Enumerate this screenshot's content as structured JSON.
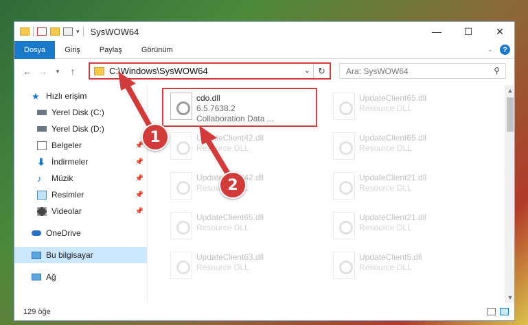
{
  "window": {
    "title": "SysWOW64",
    "controls": {
      "minimize": "—",
      "maximize": "☐",
      "close": "✕"
    }
  },
  "ribbon": {
    "tabs": [
      {
        "label": "Dosya",
        "active": true
      },
      {
        "label": "Giriş",
        "active": false
      },
      {
        "label": "Paylaş",
        "active": false
      },
      {
        "label": "Görünüm",
        "active": false
      }
    ],
    "help": "?"
  },
  "address": {
    "path": "C:\\Windows\\SysWOW64",
    "search_placeholder": "Ara: SysWOW64"
  },
  "sidebar": {
    "items": [
      {
        "label": "Hızlı erişim",
        "icon": "star-icon"
      },
      {
        "label": "Yerel Disk (C:)",
        "icon": "drive-icon"
      },
      {
        "label": "Yerel Disk (D:)",
        "icon": "drive-icon"
      },
      {
        "label": "Belgeler",
        "icon": "document-icon"
      },
      {
        "label": "İndirmeler",
        "icon": "download-icon"
      },
      {
        "label": "Müzik",
        "icon": "music-icon"
      },
      {
        "label": "Resimler",
        "icon": "picture-icon"
      },
      {
        "label": "Videolar",
        "icon": "video-icon"
      },
      {
        "label": "OneDrive",
        "icon": "cloud-icon"
      },
      {
        "label": "Bu bilgisayar",
        "icon": "computer-icon"
      },
      {
        "label": "Ağ",
        "icon": "network-icon"
      }
    ]
  },
  "files": [
    {
      "name": "cdo.dll",
      "line2": "6.5.7638.2",
      "line3": "Collaboration Data ..."
    },
    {
      "name": "UpdateClient65.dll",
      "line2": "Resource DLL"
    },
    {
      "name": "UpdateClient42.dll",
      "line2": "Resource DLL"
    },
    {
      "name": "UpdateClient65.dll",
      "line2": "Resource DLL"
    },
    {
      "name": "UpdateClient42.dll",
      "line2": "Resource DLL"
    },
    {
      "name": "UpdateClient21.dll",
      "line2": "Resource DLL"
    },
    {
      "name": "UpdateClient65.dll",
      "line2": "Resource DLL"
    },
    {
      "name": "UpdateClient21.dll",
      "line2": "Resource DLL"
    },
    {
      "name": "UpdateClient63.dll",
      "line2": "Resource DLL"
    },
    {
      "name": "UpdateClient5.dll",
      "line2": "Resource DLL"
    }
  ],
  "status": {
    "count": "129 öğe"
  },
  "badges": {
    "one": "1",
    "two": "2"
  },
  "colors": {
    "accent": "#1979ca",
    "highlight": "#d33b3b",
    "folder": "#f4c84a"
  }
}
